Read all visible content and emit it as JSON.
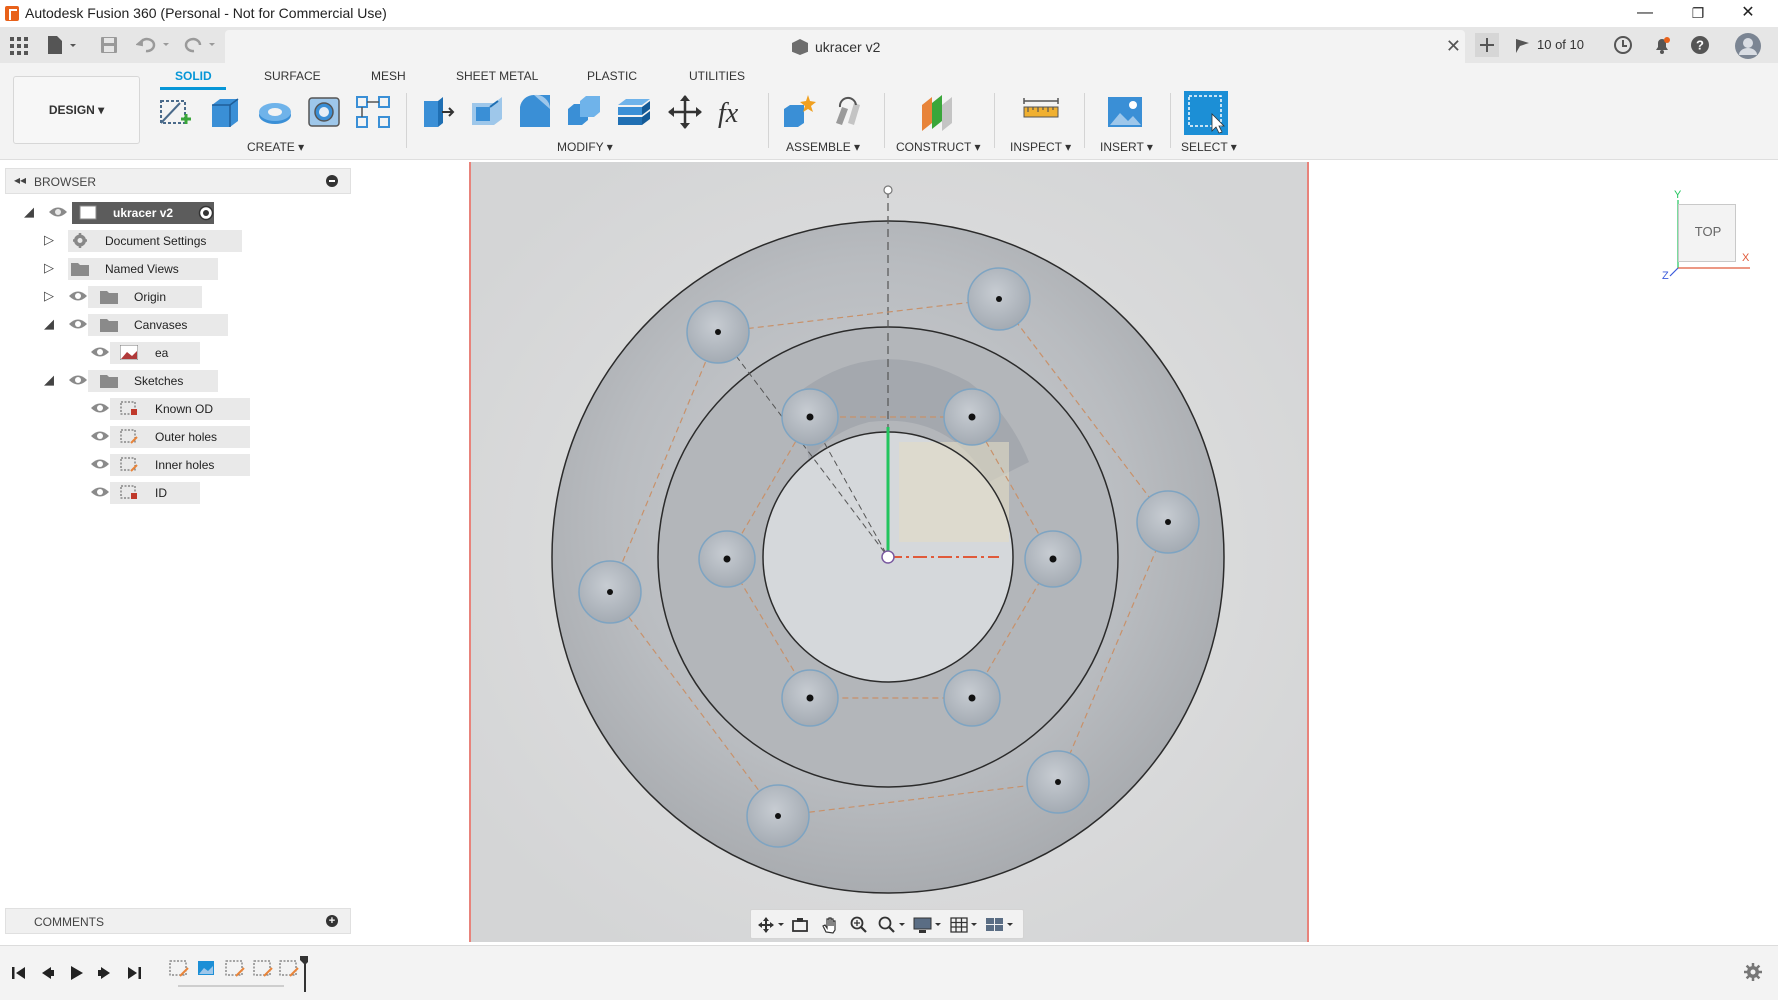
{
  "window": {
    "title": "Autodesk Fusion 360 (Personal - Not for Commercial Use)",
    "minimize": "—",
    "maximize": "❐",
    "close": "✕"
  },
  "quickbar": {
    "doc_title": "ukracer v2",
    "doc_close": "✕",
    "job_count": "10 of 10"
  },
  "toolbar": {
    "workspace": "DESIGN ▾",
    "tabs": [
      "SOLID",
      "SURFACE",
      "MESH",
      "SHEET METAL",
      "PLASTIC",
      "UTILITIES"
    ],
    "active_tab": "SOLID",
    "groups": [
      "CREATE ▾",
      "MODIFY ▾",
      "ASSEMBLE ▾",
      "CONSTRUCT ▾",
      "INSPECT ▾",
      "INSERT ▾",
      "SELECT ▾"
    ]
  },
  "browser": {
    "header": "BROWSER",
    "root": "ukracer v2",
    "items": [
      {
        "label": "Document Settings",
        "icon": "gear-icon"
      },
      {
        "label": "Named Views",
        "icon": "folder-icon"
      },
      {
        "label": "Origin",
        "icon": "folder-icon"
      },
      {
        "label": "Canvases",
        "icon": "folder-icon"
      },
      {
        "label": "ea",
        "icon": "canvas-image-icon"
      },
      {
        "label": "Sketches",
        "icon": "folder-icon"
      },
      {
        "label": "Known OD",
        "icon": "sketch-icon"
      },
      {
        "label": "Outer holes",
        "icon": "sketch-icon"
      },
      {
        "label": "Inner holes",
        "icon": "sketch-icon"
      },
      {
        "label": "ID",
        "icon": "sketch-icon"
      }
    ]
  },
  "comments": {
    "header": "COMMENTS"
  },
  "viewcube": {
    "face": "TOP",
    "axis_x": "X",
    "axis_y": "Y",
    "axis_z": "Z"
  },
  "colors": {
    "accent": "#0696d7",
    "app_orange": "#e8611a",
    "sketch_line": "#1a1a1a",
    "axis_red": "#e05a3a",
    "axis_green": "#22c55e",
    "dashed_orange": "#c8916a"
  }
}
